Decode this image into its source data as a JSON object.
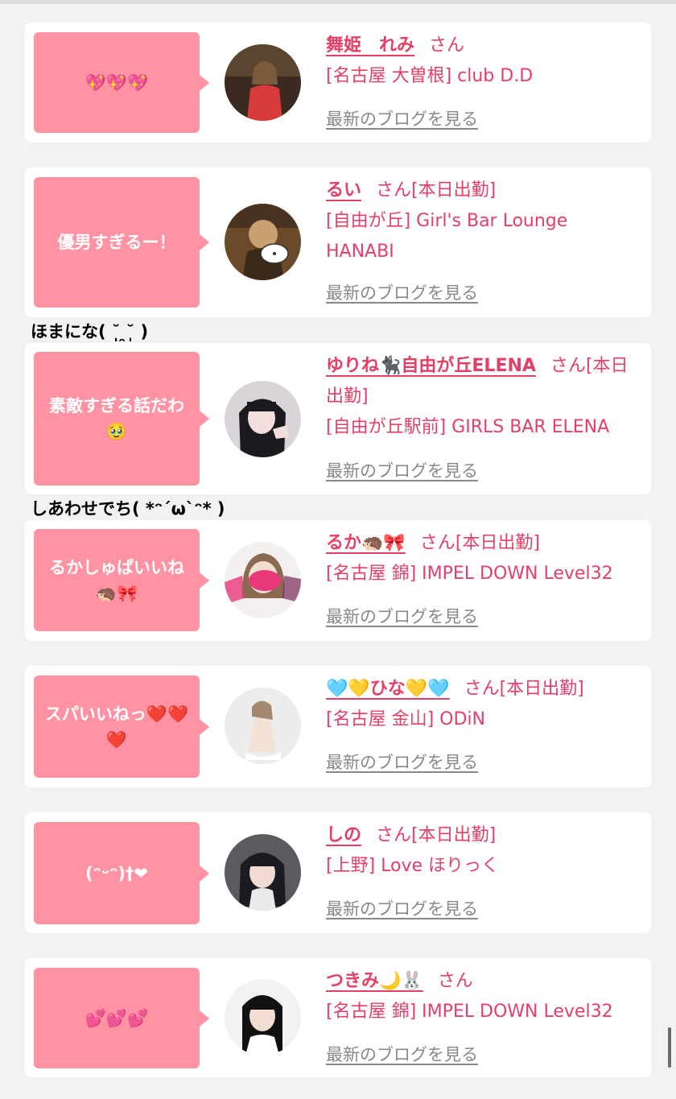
{
  "posts": [
    {
      "comment": "💖💖💖",
      "name": "舞姫　れみ",
      "san": "さん",
      "status": "",
      "shop": "[名古屋 大曽根] club D.D",
      "blog_link": "最新のブログを見る",
      "avatar_colors": [
        "#3a2a20",
        "#d63a3a",
        "#f0c8a8"
      ]
    },
    {
      "comment": "優男すぎるー！",
      "name": "るい",
      "san": "さん",
      "status": "[本日出勤]",
      "shop": "[自由が丘] Girl's Bar Lounge HANABI",
      "blog_link": "最新のブログを見る",
      "avatar_colors": [
        "#6b4a2a",
        "#c9a070",
        "#ffffff"
      ]
    },
    {
      "comment": "素敵すぎる話だわ🥹",
      "name": "ゆりね🐈‍⬛自由が丘ELENA",
      "san": "さん",
      "status": "[本日出勤]",
      "shop": "[自由が丘駅前] GIRLS BAR ELENA",
      "blog_link": "最新のブログを見る",
      "avatar_colors": [
        "#d8d4d8",
        "#1a1a1f",
        "#f3dede"
      ]
    },
    {
      "comment": "るかしゅぱいいね🦔🎀",
      "name": "るか🦔🎀",
      "san": "さん",
      "status": "[本日出勤]",
      "shop": "[名古屋 錦] IMPEL DOWN Level32",
      "blog_link": "最新のブログを見る",
      "avatar_colors": [
        "#f5f0f0",
        "#e8387a",
        "#8a6a50"
      ]
    },
    {
      "comment": "スパいいねっ❤️❤️❤️",
      "name": "🩵💛ひな💛🩵",
      "san": "さん",
      "status": "[本日出勤]",
      "shop": "[名古屋 金山] ODiN",
      "blog_link": "最新のブログを見る",
      "avatar_colors": [
        "#ececec",
        "#a58870",
        "#f3e2d6"
      ]
    },
    {
      "comment": "(ᵔᵕᵔ)†❤",
      "name": "しの",
      "san": "さん",
      "status": "[本日出勤]",
      "shop": "[上野] Love ほりっく",
      "blog_link": "最新のブログを見る",
      "avatar_colors": [
        "#5a5a5f",
        "#1b1b22",
        "#f0dcd5"
      ]
    },
    {
      "comment": "💕💕💕",
      "name": "つきみ🌙🐰",
      "san": "さん",
      "status": "",
      "shop": "[名古屋 錦] IMPEL DOWN Level32",
      "blog_link": "最新のブログを見る",
      "avatar_colors": [
        "#f2f2f2",
        "#111111",
        "#f2ddd2"
      ]
    }
  ],
  "captions": [
    "ほまにな( ˘̩̩̩ ̯˘̩̩̩ )",
    "しあわせでち( *ᵔ´ω`ᵔ* )"
  ],
  "colors": {
    "accent": "#e63f67",
    "bubble": "#ff92a3",
    "link_gray": "#888888"
  }
}
